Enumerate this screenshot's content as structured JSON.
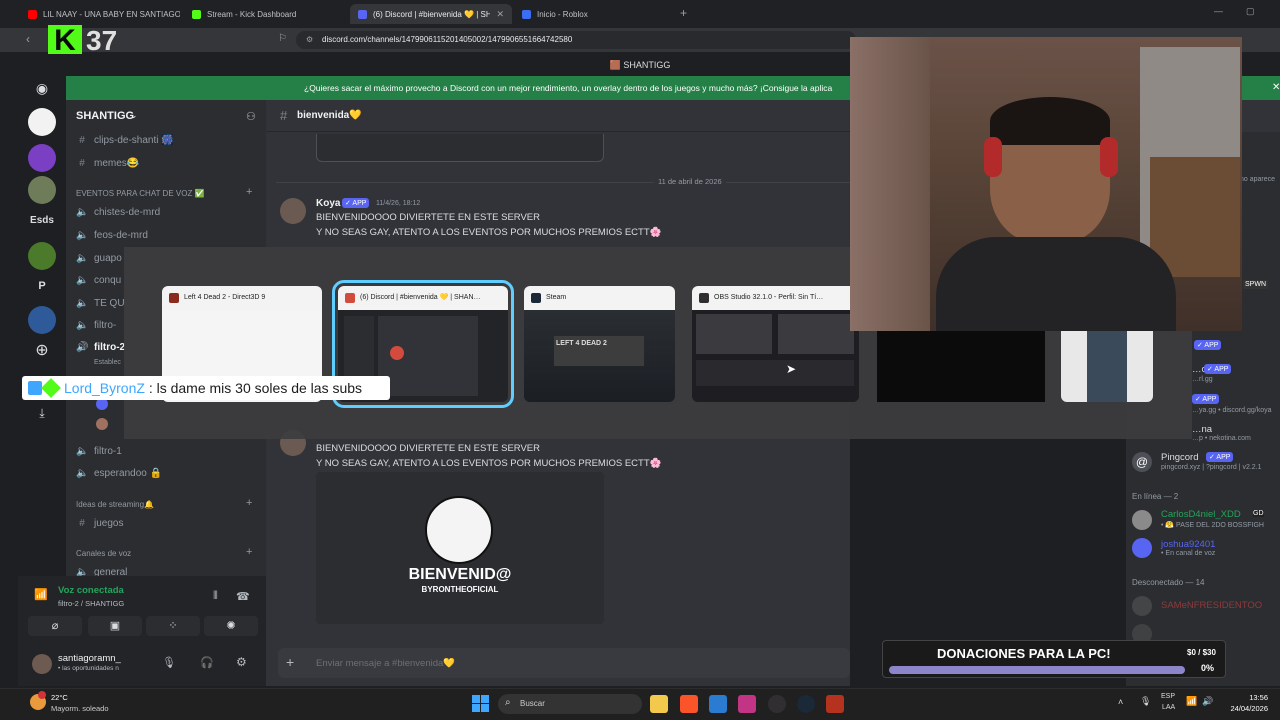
{
  "browser": {
    "tabs": [
      {
        "title": "LIL NAAY - UNA BABY EN SANTIAGO",
        "color": "#ff0000"
      },
      {
        "title": "Stream - Kick Dashboard",
        "color": "#53fc18"
      },
      {
        "title": "(6) Discord | #bienvenida 💛 | SHAN",
        "color": "#5865f2"
      },
      {
        "title": "Inicio - Roblox",
        "color": "#3b6ef5"
      }
    ],
    "url": "discord.com/channels/1479906115201405002/1479906551664742580"
  },
  "kick_overlay": {
    "logo": "K",
    "number": "37"
  },
  "discord": {
    "window_title": "SHANTIGG",
    "banner": "¿Quieres sacar el máximo provecho a Discord con un mejor rendimiento, un overlay dentro de los juegos y mucho más? ¡Consigue la aplica",
    "server_name": "SHANTIGG",
    "server_letters": [
      "Esds",
      "P"
    ],
    "channels": [
      {
        "type": "text",
        "name": "clips-de-shanti 🎆"
      },
      {
        "type": "text",
        "name": "memes😂"
      }
    ],
    "category_voice": "EVENTOS PARA CHAT DE VOZ ✅",
    "voice_channels": [
      "chistes-de-mrd",
      "feos-de-mrd",
      "guapo",
      "conqu",
      "TE QU",
      "filtro-",
      "filtro-2"
    ],
    "estab": "Establec",
    "filtro1": "filtro-1",
    "esperandoo": "esperandoo 🔒",
    "category_streaming": "Ideas de streaming🔔",
    "juegos": "juegos",
    "category_canales_voz": "Canales de voz",
    "general": "general",
    "channel_header": "bienvenida💛",
    "date_divider": "11 de abril de 2026",
    "message": {
      "author": "Koya",
      "badge": "✓ APP",
      "time": "11/4/26, 18:12",
      "line1": "BIENVENIDOOOO DIVIERTETE EN ESTE SERVER",
      "line2": "Y NO SEAS GAY, ATENTO A LOS EVENTOS POR MUCHOS PREMIOS ECTT🌸"
    },
    "welcome_card": {
      "title": "BIENVENID@",
      "subtitle": "BYRONTHEOFICIAL"
    },
    "voice_status": {
      "title": "Voz conectada",
      "sub": "filtro-2 / SHANTIGG"
    },
    "user": {
      "name": "santiagoramn_",
      "status": "• las oportunidades n"
    },
    "input_placeholder": "Enviar mensaje a #bienvenida💛",
    "members": {
      "apps": [
        {
          "name": "…ot",
          "sub": "…rl.gg",
          "badge": "✓ APP"
        },
        {
          "name": "",
          "sub": "…ya.gg • discord.gg/koya",
          "badge": "✓ APP"
        },
        {
          "name": "…na",
          "sub": "…p • nekotina.com",
          "badge": "✓ APP"
        },
        {
          "name": "Pingcord",
          "sub": "pingcord.xyz | ?pingcord | v2.2.1",
          "badge": "✓ APP"
        }
      ],
      "online_header": "En línea — 2",
      "online": [
        {
          "name": "CarlosD4niel_XDD",
          "sub": "• 😤 PASE DEL 2DO BOSSFIGH",
          "tag": "GD"
        },
        {
          "name": "joshua92401",
          "sub": "• En canal de voz",
          "tag": ""
        }
      ],
      "offline_header": "Desconectado — 14",
      "offline": [
        "SAMeNFRESIDENTOO"
      ],
      "side_text": "no aparece",
      "spwn": "SPWN"
    }
  },
  "switcher": {
    "windows": [
      {
        "title": "Left 4 Dead 2 - Direct3D 9",
        "color": "#8b2b1e"
      },
      {
        "title": "(6) Discord | #bienvenida 💛 | SHAN…",
        "color": "#d24b3c"
      },
      {
        "title": "Steam",
        "color": "#1b2838"
      },
      {
        "title": "OBS Studio 32.1.0 - Perfil: Sin Tí…",
        "color": "#302e31"
      }
    ],
    "l4d_logo": "LEFT 4 DEAD 2"
  },
  "chat_overlay": {
    "user": "Lord_ByronZ",
    "text": " : ls dame mis 30 soles de las subs"
  },
  "donation": {
    "label": "DONACIONES PARA LA PC!",
    "amount": "$0 / $30",
    "percent": "0%",
    "progress": 0
  },
  "taskbar": {
    "weather_temp": "22°C",
    "weather_desc": "Mayorm. soleado",
    "search_placeholder": "Buscar",
    "lang_top": "ESP",
    "lang_bottom": "LAA",
    "time": "13:56",
    "date": "24/04/2026"
  }
}
